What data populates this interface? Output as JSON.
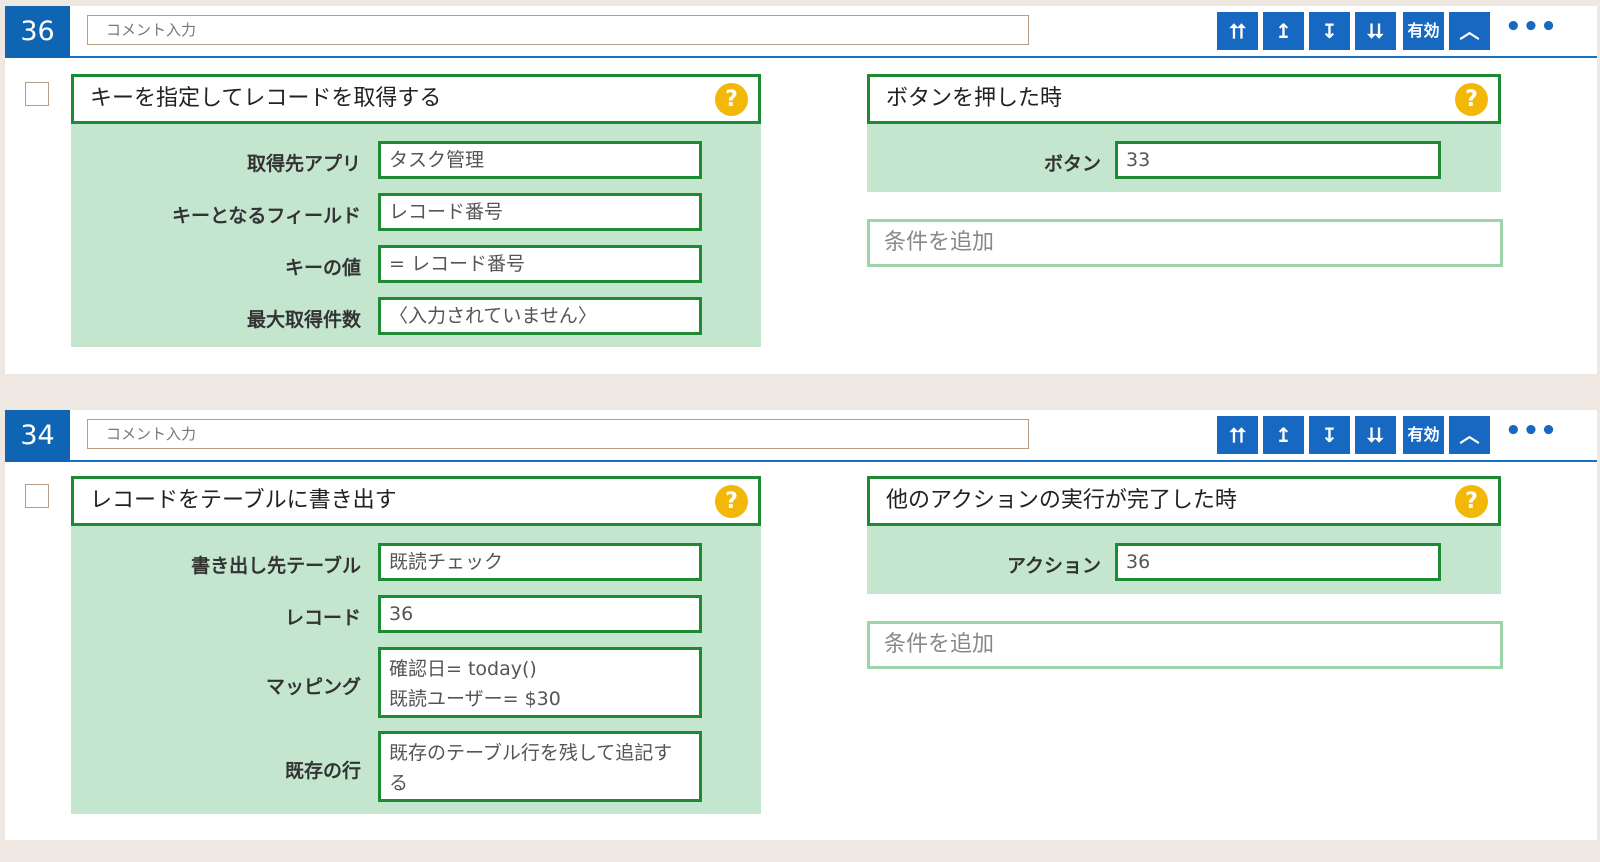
{
  "cards": [
    {
      "number": "36",
      "comment_placeholder": "コメント入力",
      "toolbar": [
        "⮅",
        "↥",
        "↧",
        "⮇",
        "有効",
        "︿",
        "•••"
      ],
      "action": {
        "title": "キーを指定してレコードを取得する",
        "help": "?",
        "fields": [
          {
            "label": "取得先アプリ",
            "value": "タスク管理"
          },
          {
            "label": "キーとなるフィールド",
            "value": "レコード番号"
          },
          {
            "label": "キーの値",
            "value": "= レコード番号"
          },
          {
            "label": "最大取得件数",
            "value": "〈入力されていません〉"
          }
        ]
      },
      "trigger": {
        "title": "ボタンを押した時",
        "help": "?",
        "field_label": "ボタン",
        "field_value": "33",
        "add_condition": "条件を追加"
      }
    },
    {
      "number": "34",
      "comment_placeholder": "コメント入力",
      "toolbar": [
        "⮅",
        "↥",
        "↧",
        "⮇",
        "有効",
        "︿",
        "•••"
      ],
      "action": {
        "title": "レコードをテーブルに書き出す",
        "help": "?",
        "fields": [
          {
            "label": "書き出し先テーブル",
            "value": "既読チェック"
          },
          {
            "label": "レコード",
            "value": "36"
          },
          {
            "label": "マッピング",
            "value_lines": [
              "確認日= today()",
              "既読ユーザー= $30"
            ]
          },
          {
            "label": "既存の行",
            "value_lines": [
              "既存のテーブル行を残して追記す",
              "る"
            ]
          }
        ]
      },
      "trigger": {
        "title": "他のアクションの実行が完了した時",
        "help": "?",
        "field_label": "アクション",
        "field_value": "36",
        "add_condition": "条件を追加"
      }
    }
  ],
  "colors": {
    "badge": "#0f64b4",
    "toolbar_button": "#1668c0",
    "green_border": "#1f8a34",
    "field_bg": "#c4e6cf",
    "help_icon": "#f2b707",
    "page_bg": "#efe7e1"
  },
  "icons": {
    "move_top": "move-to-top-icon",
    "move_up": "move-up-icon",
    "move_down": "move-down-icon",
    "move_bottom": "move-to-bottom-icon",
    "collapse": "chevron-up-icon",
    "more": "more-horizontal-icon",
    "help": "help-icon"
  }
}
